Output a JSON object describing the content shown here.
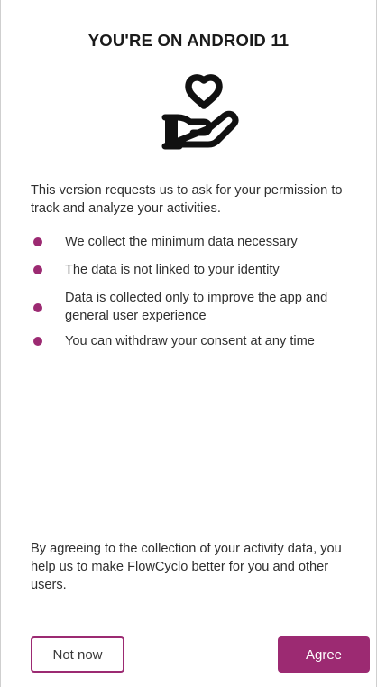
{
  "dialog": {
    "title": "YOU'RE ON ANDROID 11",
    "icon": "heart-in-hand-icon",
    "intro": "This version requests us to ask for your permission to track and analyze your activities.",
    "bullets": [
      "We collect the minimum data necessary",
      "The data is not linked to your identity",
      "Data is collected only to improve the app and general user experience",
      "You can withdraw your consent at any time"
    ],
    "outro": "By agreeing to the collection of your activity data, you help us to make FlowCyclo better for you and other users."
  },
  "actions": {
    "not_now_label": "Not now",
    "agree_label": "Agree"
  },
  "colors": {
    "accent": "#9c2a72",
    "text": "#2f2f2f",
    "background": "#ffffff"
  }
}
